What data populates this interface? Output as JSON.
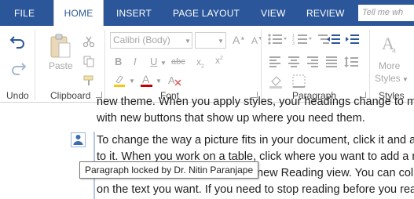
{
  "tabs": [
    {
      "label": "FILE",
      "active": false
    },
    {
      "label": "HOME",
      "active": true
    },
    {
      "label": "INSERT",
      "active": false
    },
    {
      "label": "PAGE LAYOUT",
      "active": false
    },
    {
      "label": "VIEW",
      "active": false
    },
    {
      "label": "REVIEW",
      "active": false
    }
  ],
  "tell_me": {
    "placeholder": "Tell me wh"
  },
  "ribbon": {
    "undo": {
      "label": "Undo"
    },
    "clipboard": {
      "label": "Clipboard",
      "paste_label": "Paste"
    },
    "font": {
      "label": "Font",
      "font_name": "Calibri (Body)"
    },
    "paragraph": {
      "label": "Paragraph"
    },
    "styles": {
      "label": "Styles",
      "more_line1": "More",
      "more_line2": "Styles"
    }
  },
  "document": {
    "lines": [
      "new theme. When you apply styles, your headings change to ma",
      "with new buttons that show up where you need them.",
      "To change the way a picture fits in your document, click it and a b",
      "to it. When you work on a table, click where you want to add a ro",
      "new Reading view. You can coll",
      "on the text you want. If you need to stop reading before you read"
    ]
  },
  "tooltip": {
    "text": "Paragraph locked by Dr. Nitin Paranjape"
  },
  "colors": {
    "accent": "#2b579a",
    "highlight": "#f2c811",
    "font_color": "#c00000",
    "lock_icon": "#3b6db0"
  }
}
